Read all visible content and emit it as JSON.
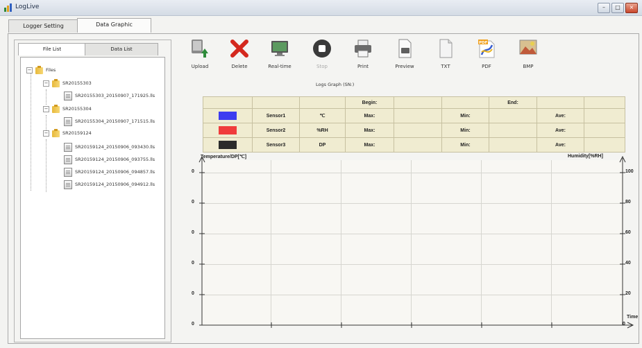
{
  "app": {
    "title": "LogLive",
    "window_buttons": [
      "–",
      "□",
      "×"
    ]
  },
  "main_tabs": [
    {
      "label": "Logger Setting"
    },
    {
      "label": "Data Graphic"
    }
  ],
  "left_tabs": [
    {
      "label": "File List"
    },
    {
      "label": "Data List"
    }
  ],
  "tree": {
    "root": {
      "label": "Files",
      "toggle": "−"
    },
    "groups": [
      {
        "label": "SR20155303",
        "files": [
          "SR20155303_20150907_171925.lls"
        ]
      },
      {
        "label": "SR20155304",
        "files": [
          "SR20155304_20150907_171515.lls"
        ]
      },
      {
        "label": "SR20159124",
        "files": [
          "SR20159124_20150906_093430.lls",
          "SR20159124_20150906_093755.lls",
          "SR20159124_20150906_094857.lls",
          "SR20159124_20150906_094912.lls"
        ]
      }
    ]
  },
  "toolbar": {
    "upload": "Upload",
    "delete": "Delete",
    "realtime": "Real-time",
    "stop": "Stop",
    "print": "Print",
    "preview": "Preview",
    "txt": "TXT",
    "pdf": "PDF",
    "bmp": "BMP",
    "pdf_badge": "PDF"
  },
  "graph": {
    "title": "Logs Graph (SN:)",
    "begin_label": "Begin:",
    "end_label": "End:",
    "max_label": "Max:",
    "min_label": "Min:",
    "ave_label": "Ave:",
    "sensors": [
      {
        "name": "Sensor1",
        "unit": "℃",
        "color": "#3c3cf0"
      },
      {
        "name": "Sensor2",
        "unit": "%RH",
        "color": "#f03c3c"
      },
      {
        "name": "Sensor3",
        "unit": "DP",
        "color": "#2b2b2b"
      }
    ],
    "left_axis_title": "Temperature/DP[℃]",
    "right_axis_title": "Humidity[%RH]",
    "time_label": "Time",
    "left_ticks": [
      "0",
      "0",
      "0",
      "0",
      "0",
      "0"
    ],
    "right_ticks": [
      "100",
      "80",
      "60",
      "40",
      "20",
      "0"
    ]
  }
}
